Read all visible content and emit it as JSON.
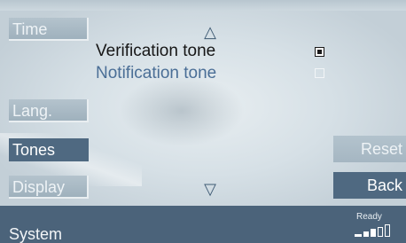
{
  "sidebar": {
    "items": [
      {
        "label": "Time",
        "active": false
      },
      {
        "label": "Lang.",
        "active": false
      },
      {
        "label": "Tones",
        "active": true
      },
      {
        "label": "Display",
        "active": false
      }
    ]
  },
  "list": {
    "scroll_up_symbol": "△",
    "scroll_down_symbol": "▽",
    "options": [
      {
        "label": "Verification tone",
        "checked": true
      },
      {
        "label": "Notification tone",
        "checked": false
      }
    ]
  },
  "right_buttons": {
    "reset_label": "Reset",
    "back_label": "Back"
  },
  "status": {
    "title": "System",
    "ready_label": "Ready",
    "signal_level": 0.4
  },
  "colors": {
    "active_button": "#4f6981",
    "status_bar": "#4b637a",
    "unselected_text": "#4a6e96"
  }
}
